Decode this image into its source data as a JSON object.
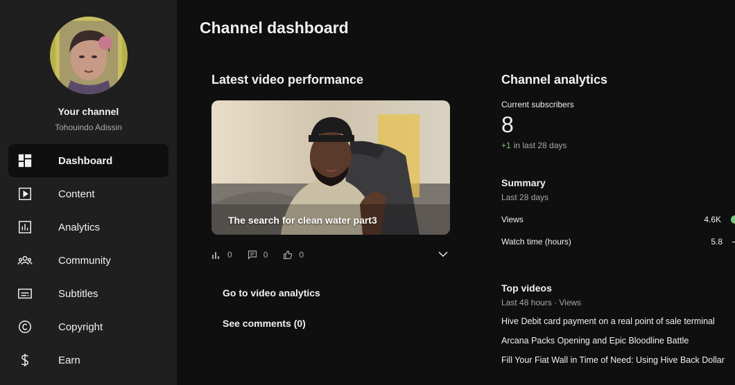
{
  "page": {
    "title": "Channel dashboard"
  },
  "channel": {
    "name": "Your channel",
    "handle": "Tohouindo Adissin"
  },
  "nav": {
    "items": [
      {
        "label": "Dashboard",
        "icon": "dashboard-icon",
        "active": true
      },
      {
        "label": "Content",
        "icon": "content-icon"
      },
      {
        "label": "Analytics",
        "icon": "analytics-icon"
      },
      {
        "label": "Community",
        "icon": "community-icon"
      },
      {
        "label": "Subtitles",
        "icon": "subtitles-icon"
      },
      {
        "label": "Copyright",
        "icon": "copyright-icon"
      },
      {
        "label": "Earn",
        "icon": "earn-icon"
      }
    ]
  },
  "latest": {
    "title": "Latest video performance",
    "video_title": "The search for clean water part3",
    "stats": {
      "views": "0",
      "comments": "0",
      "likes": "0"
    },
    "analytics_button": "Go to video analytics",
    "comments_button": "See comments (0)"
  },
  "analytics": {
    "title": "Channel analytics",
    "subscribers_label": "Current subscribers",
    "subscribers_value": "8",
    "subscribers_change": "+1",
    "subscribers_change_suffix": "in last 28 days",
    "summary": {
      "title": "Summary",
      "period": "Last 28 days",
      "metrics": [
        {
          "label": "Views",
          "value": "4.6K",
          "trend": "up"
        },
        {
          "label": "Watch time (hours)",
          "value": "5.8",
          "trend": "flat"
        }
      ]
    },
    "top_videos": {
      "title": "Top videos",
      "period": "Last 48 hours · Views",
      "items": [
        "Hive Debit card payment on a real point of sale terminal",
        "Arcana Packs Opening and Epic Bloodline Battle",
        "Fill Your Fiat Wall in Time of Need: Using Hive Back Dollar"
      ]
    }
  },
  "colors": {
    "background": "#0f0f0f",
    "sidebar": "#1f1f1f",
    "positive": "#7bc67e"
  }
}
